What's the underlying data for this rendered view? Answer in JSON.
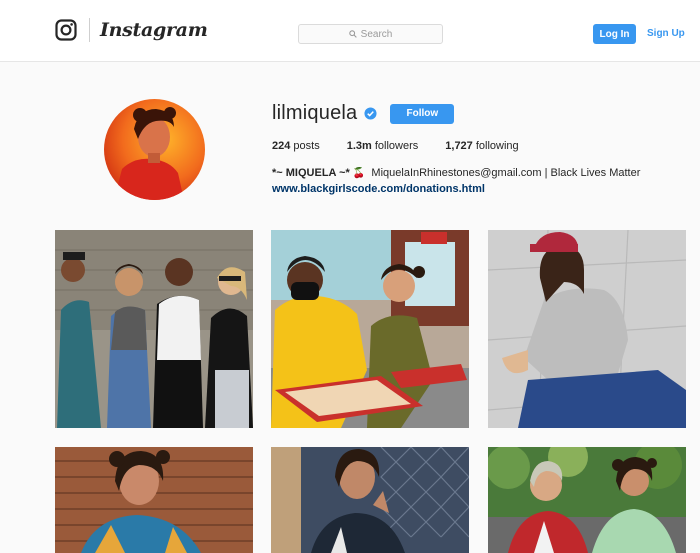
{
  "header": {
    "wordmark": "Instagram",
    "search_placeholder": "Search",
    "login_label": "Log In",
    "signup_label": "Sign Up",
    "icons": [
      "instagram-camera-icon",
      "search-icon"
    ]
  },
  "profile": {
    "username": "lilmiquela",
    "follow_label": "Follow",
    "posts_count": "224",
    "posts_label": "posts",
    "followers_count": "1.3m",
    "followers_label": "followers",
    "following_count": "1,727",
    "following_label": "following",
    "display_name": "*~ MIQUELA ~*",
    "cherry_emoji": "🍒",
    "bio": "MiquelaInRhinestones@gmail.com | Black Lives Matter",
    "link": "www.blackgirlscode.com/donations.html",
    "icons": [
      "verified-badge-icon",
      "cherry-icon"
    ]
  },
  "posts": [
    {
      "name": "group-photo-brick-wall"
    },
    {
      "name": "diner-photo-mask"
    },
    {
      "name": "seated-red-cap"
    },
    {
      "name": "brick-wall-portrait"
    },
    {
      "name": "chain-fence-portrait"
    },
    {
      "name": "duo-greenery"
    }
  ],
  "colors": {
    "accent": "#3897f0",
    "link": "#003569",
    "background": "#fafafa"
  }
}
